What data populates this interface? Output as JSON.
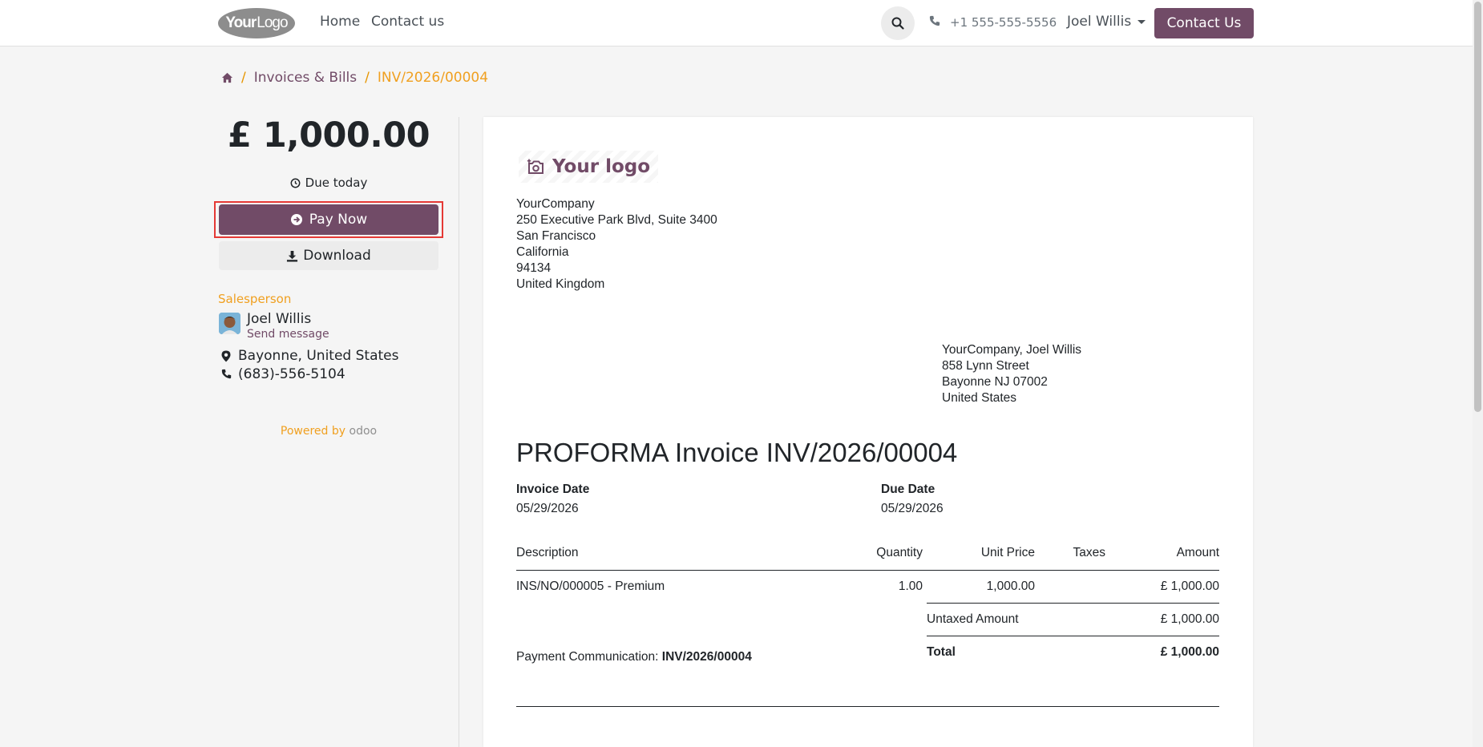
{
  "header": {
    "logo_text": "Your",
    "logo_text2": "Logo",
    "nav": [
      "Home",
      "Contact us"
    ],
    "phone": "+1 555-555-5556",
    "user": "Joel Willis",
    "contact_button": "Contact Us"
  },
  "breadcrumb": {
    "home_icon": "home-icon",
    "items": [
      "Invoices & Bills",
      "INV/2026/00004"
    ]
  },
  "sidebar": {
    "amount": "£ 1,000.00",
    "due": "Due today",
    "pay_now": "Pay Now",
    "download": "Download",
    "salesperson_label": "Salesperson",
    "salesperson_name": "Joel Willis",
    "send_message": "Send message",
    "location": "Bayonne, United States",
    "phone": "(683)-556-5104",
    "powered_by": "Powered by",
    "odoo": "odoo"
  },
  "invoice": {
    "logo_text": "Your logo",
    "company": [
      "YourCompany",
      "250 Executive Park Blvd, Suite 3400",
      "San Francisco",
      "California",
      "94134",
      "United Kingdom"
    ],
    "recipient": [
      "YourCompany, Joel Willis",
      "858 Lynn Street",
      "Bayonne NJ 07002",
      "United States"
    ],
    "title": "PROFORMA Invoice INV/2026/00004",
    "invoice_date_label": "Invoice Date",
    "invoice_date": "05/29/2026",
    "due_date_label": "Due Date",
    "due_date": "05/29/2026",
    "columns": [
      "Description",
      "Quantity",
      "Unit Price",
      "Taxes",
      "Amount"
    ],
    "lines": [
      {
        "description": "INS/NO/000005 - Premium",
        "quantity": "1.00",
        "unit_price": "1,000.00",
        "taxes": "",
        "amount": "£ 1,000.00"
      }
    ],
    "untaxed_label": "Untaxed Amount",
    "untaxed_value": "£ 1,000.00",
    "total_label": "Total",
    "total_value": "£ 1,000.00",
    "payment_comm_label": "Payment Communication:",
    "payment_comm_value": "INV/2026/00004"
  },
  "colors": {
    "primary": "#714b67",
    "accent": "#f0a020",
    "highlight": "#e53935"
  }
}
